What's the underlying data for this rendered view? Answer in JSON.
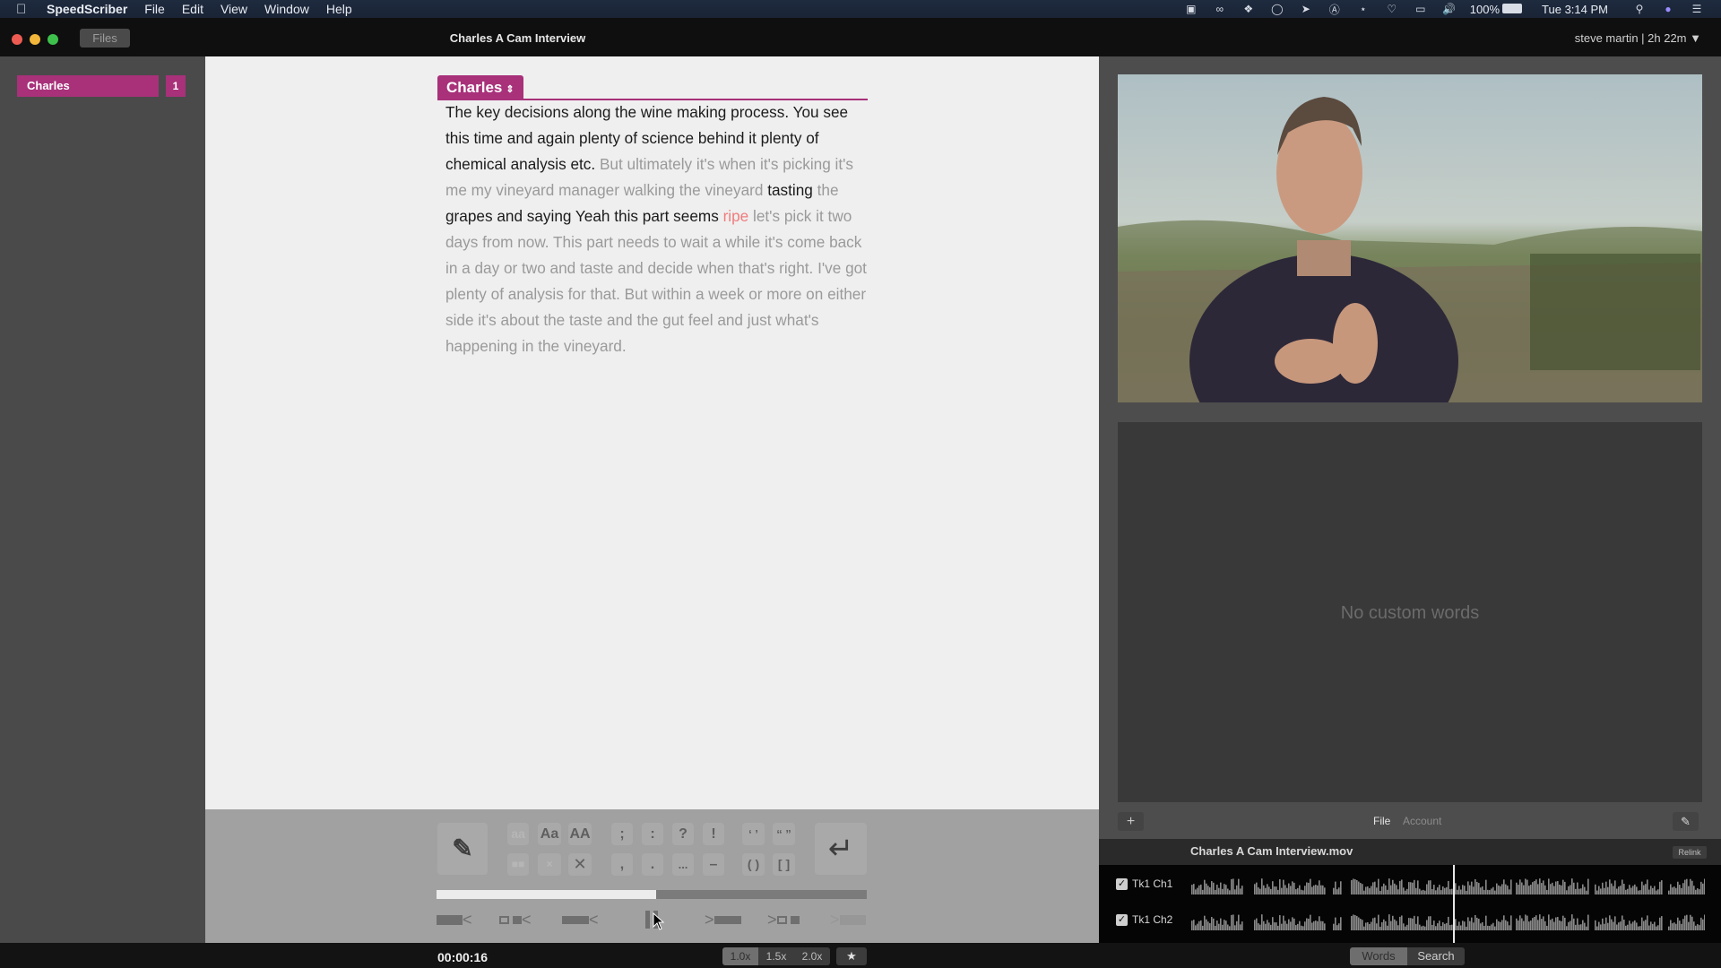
{
  "menubar": {
    "app_name": "SpeedScriber",
    "menus": [
      "File",
      "Edit",
      "View",
      "Window",
      "Help"
    ],
    "tray_icons": [
      "camera-icon",
      "creative-cloud-icon",
      "dropbox-icon",
      "onepassword-icon",
      "forward-icon",
      "a-icon",
      "bluetooth-icon",
      "wifi-icon",
      "airplay-icon",
      "volume-icon"
    ],
    "battery": "100%",
    "clock": "Tue 3:14 PM"
  },
  "window": {
    "files_button": "Files",
    "title": "Charles A Cam Interview",
    "account": "steve martin | 2h 22m ▼"
  },
  "sidebar": {
    "speakers": [
      {
        "name": "Charles",
        "count": "1"
      }
    ]
  },
  "transcript": {
    "speaker": "Charles",
    "segments": [
      {
        "text": "The key decisions along the wine making process. You see this time and again plenty of science behind it plenty of chemical analysis etc. ",
        "style": "normal"
      },
      {
        "text": "But ultimately it's when it's picking it's me my vineyard manager walking the vineyard ",
        "style": "dim"
      },
      {
        "text": "tasting ",
        "style": "normal"
      },
      {
        "text": "the ",
        "style": "dim"
      },
      {
        "text": "grapes and saying Yeah this part seems ",
        "style": "normal"
      },
      {
        "text": "ripe",
        "style": "flag"
      },
      {
        "text": " let's pick it two days from now. This part needs to wait a while it's come back in a day or two and taste and decide when that's right. I've got plenty of analysis for that. But within a week or more on either side it's about the taste and the gut feel and just what's happening in the vineyard.",
        "style": "dim"
      }
    ]
  },
  "toolbar": {
    "case_lower": "aa",
    "case_title": "Aa",
    "case_upper": "AA",
    "semicolon": ";",
    "colon": ":",
    "question": "?",
    "exclaim": "!",
    "single_quotes": "‘ ’",
    "double_quotes": "“ ”",
    "comma": ",",
    "period": ".",
    "ellipsis": "...",
    "dash": "–",
    "parens": "( )",
    "brackets": "[ ]",
    "delete_small": "×",
    "delete": "✕",
    "return": "↵",
    "pencil": "✎",
    "progress_fraction": 0.51
  },
  "statusbar": {
    "timecode": "00:00:16",
    "speeds": [
      "1.0x",
      "1.5x",
      "2.0x"
    ],
    "active_speed": "1.0x",
    "star": "★",
    "tabs": [
      "Words",
      "Search"
    ],
    "active_tab": "Words"
  },
  "right_panel": {
    "empty_words_message": "No custom words",
    "add_button": "+",
    "edit_button": "✎",
    "tabs": [
      "File",
      "Account"
    ],
    "active_tab": "File",
    "clip_name": "Charles A Cam Interview.mov",
    "relink_button": "Relink",
    "tracks": [
      {
        "label": "Tk1 Ch1",
        "checked": true
      },
      {
        "label": "Tk1 Ch2",
        "checked": true
      }
    ],
    "playhead_fraction": 0.51
  }
}
